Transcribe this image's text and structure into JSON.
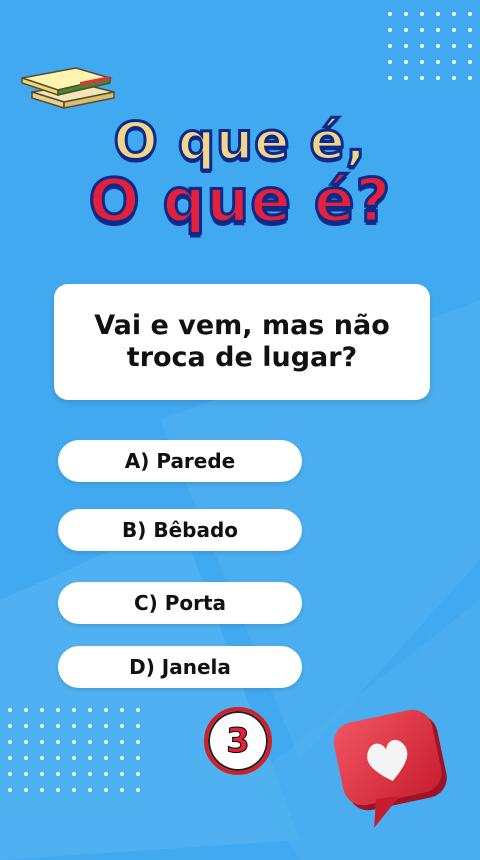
{
  "title": {
    "line1": "O que é,",
    "line2": "O que é?"
  },
  "question": "Vai e vem, mas não troca de lugar?",
  "options": [
    {
      "label": "A) Parede"
    },
    {
      "label": "B) Bêbado"
    },
    {
      "label": "C) Porta"
    },
    {
      "label": "D) Janela"
    }
  ],
  "timer": {
    "value": "3"
  },
  "colors": {
    "background": "#41a9ef",
    "title_top": "#f2d48a",
    "title_bottom": "#e5203a",
    "outline": "#0d2a8a",
    "like_bubble": "#e63946"
  },
  "icons": {
    "decoration": "books-icon",
    "reaction": "heart-icon"
  }
}
